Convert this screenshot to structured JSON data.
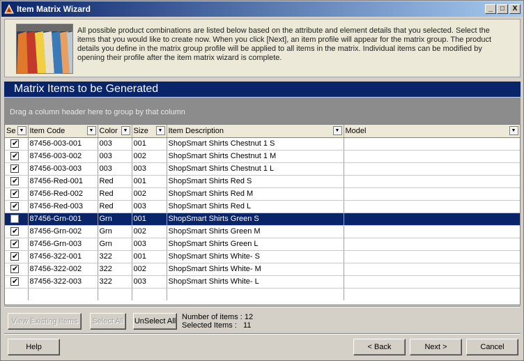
{
  "window": {
    "title": "Item Matrix Wizard",
    "min_glyph": "_",
    "max_glyph": "□",
    "close_glyph": "X"
  },
  "intro": {
    "description": "All possible product combinations are listed below based on the attribute and element details that you selected. Select the items that you would like to create now. When you click [Next], an item profile will appear for the matrix group. The product details you define in the matrix group profile will be applied to all items in the matrix. Individual items can be modified by opening their profile after the item matrix wizard is complete."
  },
  "section": {
    "title": "Matrix Items to be Generated"
  },
  "group_area": {
    "hint": "Drag a column header here to group by that column"
  },
  "grid": {
    "columns": [
      "Se",
      "Item Code",
      "Color",
      "Size",
      "Item Description",
      "Model"
    ],
    "rows": [
      {
        "checked": true,
        "code": "87456-003-001",
        "color": "003",
        "size": "001",
        "desc": "ShopSmart Shirts Chestnut 1 S",
        "model": ""
      },
      {
        "checked": true,
        "code": "87456-003-002",
        "color": "003",
        "size": "002",
        "desc": "ShopSmart Shirts Chestnut 1 M",
        "model": ""
      },
      {
        "checked": true,
        "code": "87456-003-003",
        "color": "003",
        "size": "003",
        "desc": "ShopSmart Shirts Chestnut 1 L",
        "model": ""
      },
      {
        "checked": true,
        "code": "87456-Red-001",
        "color": "Red",
        "size": "001",
        "desc": "ShopSmart Shirts Red S",
        "model": ""
      },
      {
        "checked": true,
        "code": "87456-Red-002",
        "color": "Red",
        "size": "002",
        "desc": "ShopSmart Shirts Red M",
        "model": ""
      },
      {
        "checked": true,
        "code": "87456-Red-003",
        "color": "Red",
        "size": "003",
        "desc": "ShopSmart Shirts Red L",
        "model": ""
      },
      {
        "checked": false,
        "code": "87456-Grn-001",
        "color": "Grn",
        "size": "001",
        "desc": "ShopSmart Shirts Green S",
        "model": "",
        "selected": true
      },
      {
        "checked": true,
        "code": "87456-Grn-002",
        "color": "Grn",
        "size": "002",
        "desc": "ShopSmart Shirts Green M",
        "model": ""
      },
      {
        "checked": true,
        "code": "87456-Grn-003",
        "color": "Grn",
        "size": "003",
        "desc": "ShopSmart Shirts Green L",
        "model": ""
      },
      {
        "checked": true,
        "code": "87456-322-001",
        "color": "322",
        "size": "001",
        "desc": "ShopSmart Shirts White- S",
        "model": ""
      },
      {
        "checked": true,
        "code": "87456-322-002",
        "color": "322",
        "size": "002",
        "desc": "ShopSmart Shirts White- M",
        "model": ""
      },
      {
        "checked": true,
        "code": "87456-322-003",
        "color": "322",
        "size": "003",
        "desc": "ShopSmart Shirts White- L",
        "model": ""
      }
    ]
  },
  "actions": {
    "view_existing": "View Existing Items",
    "select_all": "Select All",
    "unselect_all": "UnSelect All"
  },
  "stats": {
    "number_label": "Number of items :",
    "number_value": "12",
    "selected_label": "Selected Items :",
    "selected_value": "11"
  },
  "footer": {
    "help": "Help",
    "back": "< Back",
    "next": "Next >",
    "cancel": "Cancel"
  },
  "colors": {
    "header_blue": "#0a246a",
    "selection_blue": "#0a246a",
    "group_gray": "#8c8c8c"
  }
}
